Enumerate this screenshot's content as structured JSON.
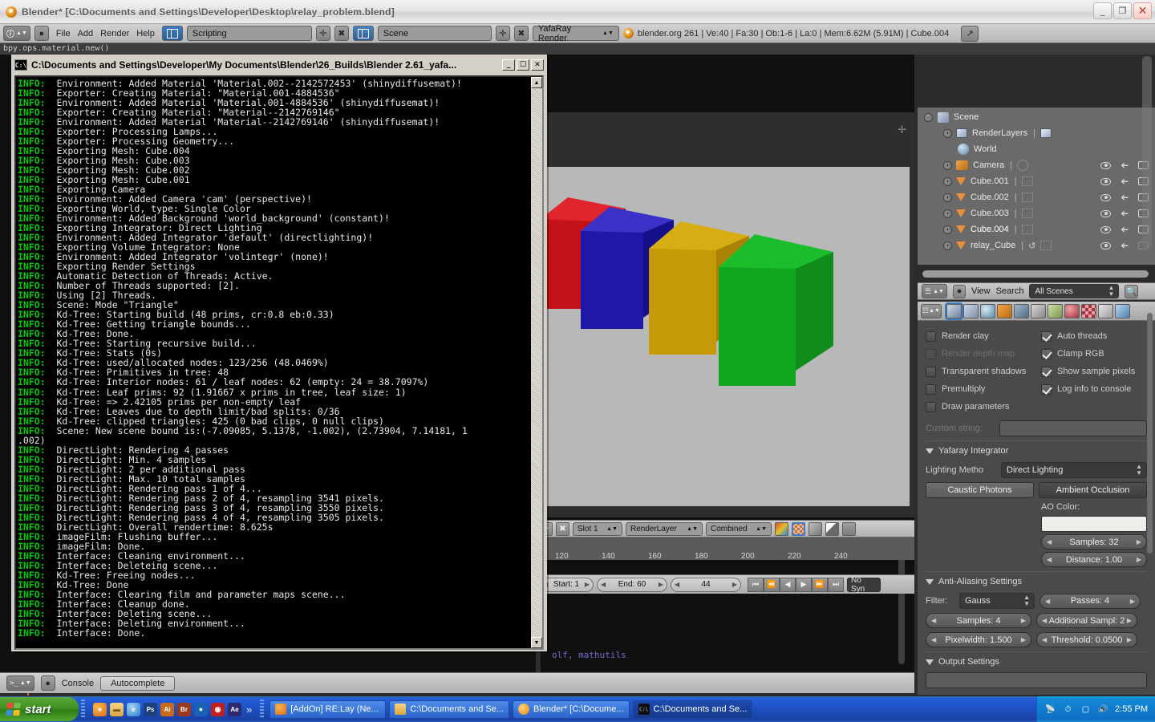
{
  "window": {
    "title": "Blender* [C:\\Documents and Settings\\Developer\\Desktop\\relay_problem.blend]",
    "minimize_label": "_",
    "maximize_label": "❐",
    "close_label": "✕"
  },
  "blender_header": {
    "editor_type_label": "Scripting",
    "menus": [
      "File",
      "Add",
      "Render",
      "Help"
    ],
    "scene_name": "Scene",
    "engine": "YafaRay Render",
    "plus_label": "✛",
    "x_label": "✖",
    "stats": "blender.org 261 | Ve:40 | Fa:30 | Ob:1-6 | La:0 | Mem:6.62M (5.91M) | Cube.004"
  },
  "script_line": "bpy.ops.material.new()",
  "text_editor": {
    "code_fragment": "olf, mathutils",
    "prompt": ">>>"
  },
  "blender_footer": {
    "editor_label": "Console",
    "autocomplete_label": "Autocomplete"
  },
  "console_window": {
    "title": "C:\\Documents and Settings\\Developer\\My Documents\\Blender\\26_Builds\\Blender 2.61_yafa...",
    "icon_label": "C:\\",
    "minimize": "_",
    "maximize": "☐",
    "close": "✕",
    "scroll_up": "▲",
    "scroll_down": "▼",
    "prefix": "INFO:",
    "lines": [
      "Environment: Added Material 'Material.002--2142572453' (shinydiffusemat)!",
      "Exporter: Creating Material: \"Material.001-4884536\"",
      "Environment: Added Material 'Material.001-4884536' (shinydiffusemat)!",
      "Exporter: Creating Material: \"Material--2142769146\"",
      "Environment: Added Material 'Material--2142769146' (shinydiffusemat)!",
      "Exporter: Processing Lamps...",
      "Exporter: Processing Geometry...",
      "Exporting Mesh: Cube.004",
      "Exporting Mesh: Cube.003",
      "Exporting Mesh: Cube.002",
      "Exporting Mesh: Cube.001",
      "Exporting Camera",
      "Environment: Added Camera 'cam' (perspective)!",
      "Exporting World, type: Single Color",
      "Environment: Added Background 'world_background' (constant)!",
      "Exporting Integrator: Direct Lighting",
      "Environment: Added Integrator 'default' (directlighting)!",
      "Exporting Volume Integrator: None",
      "Environment: Added Integrator 'volintegr' (none)!",
      "Exporting Render Settings",
      "Automatic Detection of Threads: Active.",
      "Number of Threads supported: [2].",
      "Using [2] Threads.",
      "Scene: Mode \"Triangle\"",
      "Kd-Tree: Starting build (48 prims, cr:0.8 eb:0.33)",
      "Kd-Tree: Getting triangle bounds...",
      "Kd-Tree: Done.",
      "Kd-Tree: Starting recursive build...",
      "Kd-Tree: Stats (0s)",
      "Kd-Tree: used/allocated nodes: 123/256 (48.0469%)",
      "Kd-Tree: Primitives in tree: 48",
      "Kd-Tree: Interior nodes: 61 / leaf nodes: 62 (empty: 24 = 38.7097%)",
      "Kd-Tree: Leaf prims: 92 (1.91667 x prims in tree, leaf size: 1)",
      "Kd-Tree: => 2.42105 prims per non-empty leaf",
      "Kd-Tree: Leaves due to depth limit/bad splits: 0/36",
      "Kd-Tree: clipped triangles: 425 (0 bad clips, 0 null clips)",
      "Scene: New scene bound is:(-7.09085, 5.1378, -1.002), (2.73904, 7.14181, 1",
      "DirectLight: Rendering 4 passes",
      "DirectLight: Min. 4 samples",
      "DirectLight: 2 per additional pass",
      "DirectLight: Max. 10 total samples",
      "DirectLight: Rendering pass 1 of 4...",
      "DirectLight: Rendering pass 2 of 4, resampling 3541 pixels.",
      "DirectLight: Rendering pass 3 of 4, resampling 3550 pixels.",
      "DirectLight: Rendering pass 4 of 4, resampling 3505 pixels.",
      "DirectLight: Overall rendertime: 8.625s",
      "imageFilm: Flushing buffer...",
      "imageFilm: Done.",
      "Interface: Cleaning environment...",
      "Interface: Deleteing scene...",
      "Kd-Tree: Freeing nodes...",
      "Kd-Tree: Done",
      "Interface: Clearing film and parameter maps scene...",
      "Interface: Cleanup done.",
      "Interface: Deleting scene...",
      "Interface: Deleting environment...",
      "Interface: Done."
    ],
    "wrap_line": ".002)",
    "wrap_after_index": 36
  },
  "render": {
    "plus_label": "✛",
    "cubes": [
      {
        "name": "cube-red",
        "color": "#c4121a",
        "top": "#e0262c",
        "side": "#8c0d13"
      },
      {
        "name": "cube-blue",
        "color": "#1f17a8",
        "top": "#3a32c8",
        "side": "#16108a"
      },
      {
        "name": "cube-yellow",
        "color": "#c59a06",
        "top": "#d8ad14",
        "side": "#a98206"
      },
      {
        "name": "cube-green",
        "color": "#12a520",
        "top": "#1bbd2a",
        "side": "#0f8c1a"
      }
    ],
    "background": "#b8b8b8"
  },
  "image_header": {
    "plus_label": "✛",
    "x_label": "✖",
    "slot": "Slot 1",
    "layer": "RenderLayer",
    "pass": "Combined",
    "toggles": [
      "color-swatch-icon",
      "alpha-checker-icon",
      "zbuffer-icon",
      "luminance-icon",
      "render-icon"
    ]
  },
  "timeline": {
    "ticks": [
      "120",
      "140",
      "160",
      "180",
      "200",
      "220",
      "240"
    ],
    "start_label": "Start: 1",
    "end_label": "End: 60",
    "current_frame": "44",
    "sync_label": "No Syn",
    "transport": [
      "⏮",
      "⏪",
      "◀",
      "▶",
      "⏩",
      "⏭"
    ]
  },
  "outliner": {
    "header": {
      "view_label": "View",
      "search_label": "Search",
      "scope": "All Scenes",
      "search_icon": "magnifier-icon"
    },
    "items": [
      {
        "label": "Scene",
        "icon": "scene-icon",
        "indent": 0,
        "expander": "−",
        "selected": false,
        "show_restrict": false
      },
      {
        "label": "RenderLayers",
        "icon": "renderlayer-icon",
        "indent": 1,
        "expander": "+",
        "selected": false,
        "show_restrict": false
      },
      {
        "label": "World",
        "icon": "world-icon",
        "indent": 1,
        "expander": "",
        "selected": false,
        "show_restrict": false
      },
      {
        "label": "Camera",
        "icon": "camera-icon",
        "indent": 1,
        "expander": "+",
        "selected": false,
        "show_restrict": true
      },
      {
        "label": "Cube.001",
        "icon": "mesh-icon",
        "indent": 1,
        "expander": "+",
        "selected": false,
        "show_restrict": true
      },
      {
        "label": "Cube.002",
        "icon": "mesh-icon",
        "indent": 1,
        "expander": "+",
        "selected": false,
        "show_restrict": true
      },
      {
        "label": "Cube.003",
        "icon": "mesh-icon",
        "indent": 1,
        "expander": "+",
        "selected": false,
        "show_restrict": true
      },
      {
        "label": "Cube.004",
        "icon": "mesh-icon",
        "indent": 1,
        "expander": "+",
        "selected": true,
        "show_restrict": true
      },
      {
        "label": "relay_Cube",
        "icon": "mesh-icon",
        "indent": 1,
        "expander": "+",
        "selected": false,
        "show_restrict": true
      }
    ]
  },
  "properties": {
    "tabs": [
      "render-icon",
      "scene-icon",
      "world-icon",
      "object-icon",
      "constraint-icon",
      "modifier-icon",
      "data-icon",
      "material-icon",
      "texture-icon",
      "particles-icon",
      "physics-icon"
    ],
    "selected_tab_index": 0,
    "checkboxes_left": [
      {
        "label": "Render clay",
        "checked": false,
        "disabled": false
      },
      {
        "label": "Render depth map",
        "checked": false,
        "disabled": true
      },
      {
        "label": "Transparent shadows",
        "checked": false,
        "disabled": false
      },
      {
        "label": "Premultiply",
        "checked": false,
        "disabled": false
      },
      {
        "label": "Draw parameters",
        "checked": false,
        "disabled": false
      }
    ],
    "checkboxes_right": [
      {
        "label": "Auto threads",
        "checked": true
      },
      {
        "label": "Clamp RGB",
        "checked": true
      },
      {
        "label": "Show sample pixels",
        "checked": true
      },
      {
        "label": "Log info to console",
        "checked": true
      }
    ],
    "custom_string_label": "Custom string:",
    "custom_string_value": "",
    "integrator": {
      "panel_title": "Yafaray Integrator",
      "lighting_label": "Lighting Metho",
      "lighting_value": "Direct Lighting",
      "caustic_label": "Caustic Photons",
      "ao_label": "Ambient Occlusion",
      "ao_color_label": "AO Color:",
      "ao_color": "#eeeeea",
      "samples": "Samples: 32",
      "distance": "Distance: 1.00"
    },
    "antialiasing": {
      "panel_title": "Anti-Aliasing Settings",
      "filter_label": "Filter:",
      "filter_value": "Gauss",
      "passes": "Passes: 4",
      "samples": "Samples: 4",
      "additional": "Additional Sampl: 2",
      "pixelwidth": "Pixelwidth: 1.500",
      "threshold": "Threshold: 0.0500"
    },
    "output": {
      "panel_title": "Output Settings"
    }
  },
  "taskbar": {
    "start_label": "start",
    "quick_launch": [
      {
        "name": "firefox-icon",
        "glyph": "e",
        "color": "#d86b1a"
      },
      {
        "name": "folder-icon",
        "glyph": "▤",
        "color": "#d8a43c"
      },
      {
        "name": "ie-icon",
        "glyph": "e",
        "color": "#3f8fd8"
      },
      {
        "name": "photoshop-icon",
        "glyph": "Ps",
        "color": "#1c3f80"
      },
      {
        "name": "illustrator-icon",
        "glyph": "Ai",
        "color": "#c86a1a"
      },
      {
        "name": "bridge-icon",
        "glyph": "Br",
        "color": "#9a3a1a"
      },
      {
        "name": "media-icon",
        "glyph": "●",
        "color": "#1b62b5"
      },
      {
        "name": "acrobat-icon",
        "glyph": "◉",
        "color": "#c02020"
      },
      {
        "name": "aftereffects-icon",
        "glyph": "Ae",
        "color": "#2b2b6e"
      }
    ],
    "overflow_label": "»",
    "tasks": [
      {
        "label": "[AddOn] RE:Lay (Ne...",
        "icon": "firefox-icon",
        "color": "#d86b1a",
        "active": false
      },
      {
        "label": "C:\\Documents and Se...",
        "icon": "folder-icon",
        "color": "#d8a43c",
        "active": false
      },
      {
        "label": "Blender* [C:\\Docume...",
        "icon": "blender-icon",
        "color": "#e08a15",
        "active": false
      },
      {
        "label": "C:\\Documents and Se...",
        "icon": "console-icon",
        "color": "#111111",
        "active": true
      }
    ],
    "tray_icons": [
      "network-icon",
      "clock-icon",
      "battery-icon",
      "volume-icon"
    ],
    "clock": "2:55 PM"
  }
}
